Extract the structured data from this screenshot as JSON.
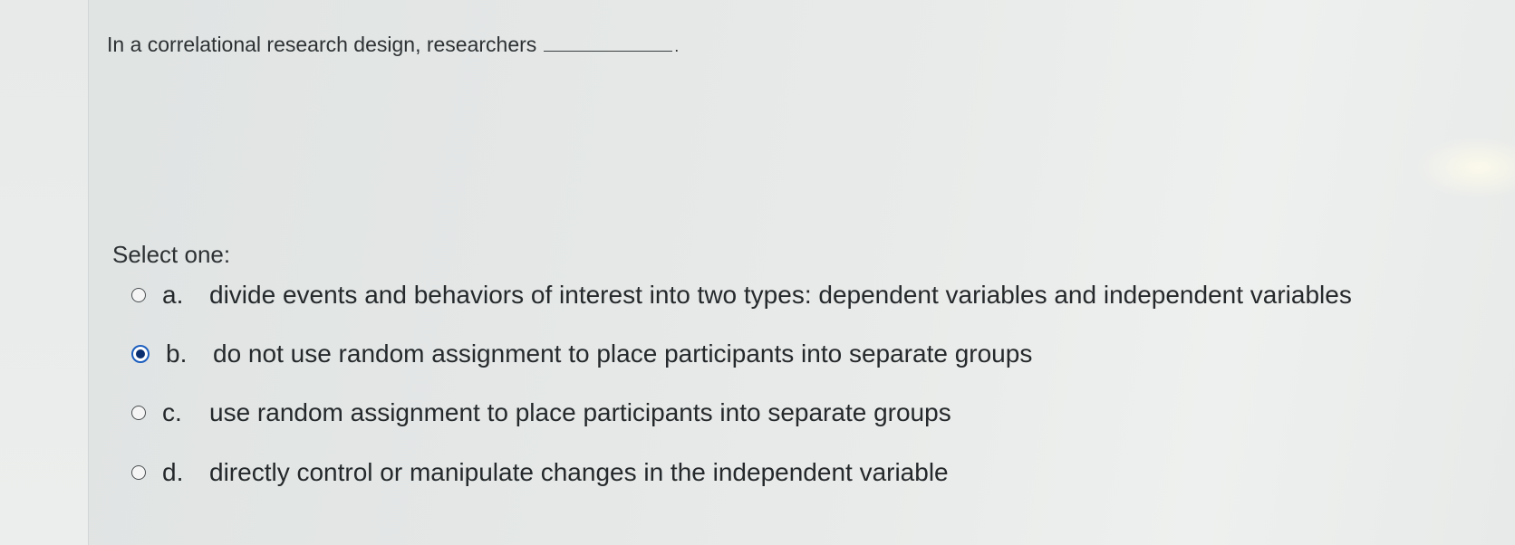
{
  "question": {
    "text": "In a correlational research design, researchers",
    "period": "."
  },
  "prompt": "Select one:",
  "answers": [
    {
      "letter": "a.",
      "text": "divide events and behaviors of interest into two types: dependent variables and independent variables",
      "selected": false
    },
    {
      "letter": "b.",
      "text": "do not use random assignment to place participants into separate groups",
      "selected": true
    },
    {
      "letter": "c.",
      "text": "use random assignment to place participants into separate groups",
      "selected": false
    },
    {
      "letter": "d.",
      "text": "directly control or manipulate changes in the independent variable",
      "selected": false
    }
  ],
  "colors": {
    "radio_selected_ring": "#1d5fbf",
    "radio_selected_dot": "#0b2f6e"
  }
}
